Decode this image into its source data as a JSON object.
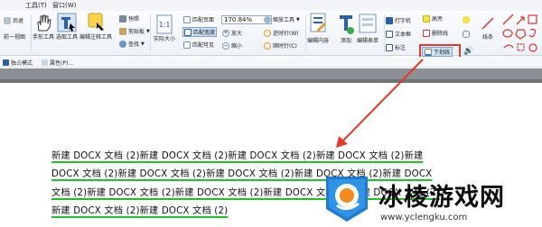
{
  "menu": {
    "items": [
      "",
      "工具(T)",
      "窗口(W)"
    ]
  },
  "ribbon": {
    "back": "后退",
    "forward": "前一视图",
    "hand_tool": "手形工具",
    "select_text_tool": "选取工具",
    "annotation_tool": "编辑注释工具",
    "snapshot": "快照",
    "clipboard": "剪贴板",
    "find": "查找",
    "actual_size": "实际大小",
    "fit_page": "匹配页面",
    "fit_width": "匹配宽度",
    "fit_visible": "匹配可见",
    "zoom_value": "170.84%",
    "zoom_in": "放大",
    "zoom_out": "缩小",
    "zoom_tool": "缩放工具",
    "rotate_ccw": "逆时针(W)",
    "rotate_cw": "顺时针(C)",
    "edit_content": "编辑内容",
    "add": "添加",
    "edit_form": "编辑表单",
    "typewriter": "打字机",
    "text_box": "文本框",
    "callout": "标注",
    "highlight": "高亮",
    "strikeout": "删除线",
    "underline": "下划线",
    "line": "线条"
  },
  "subbar": {
    "reading_mode": "独占模式",
    "properties": "属性(P)..."
  },
  "document": {
    "lines": [
      "新建 DOCX 文档 (2)新建 DOCX 文档 (2)新建 DOCX 文档 (2)新建 DOCX 文档 (2)新建",
      "DOCX 文档 (2)新建 DOCX 文档 (2)新建 DOCX 文档 (2)新建 DOCX 文档 (2)新建 DOCX",
      "文档 (2)新建 DOCX 文档 (2)新建 DOCX 文档 (2)新建 DOCX 文档 (2)新建 DOCX 文档 (2)",
      "新建 DOCX 文档 (2)新建 DOCX 文档 (2)"
    ]
  },
  "watermark": {
    "title": "冰棱游戏网",
    "url": "www.yclengku.com"
  },
  "colors": {
    "underline": "#22c02a",
    "arrow": "#e23a2a",
    "accent_blue": "#2b78d0"
  }
}
